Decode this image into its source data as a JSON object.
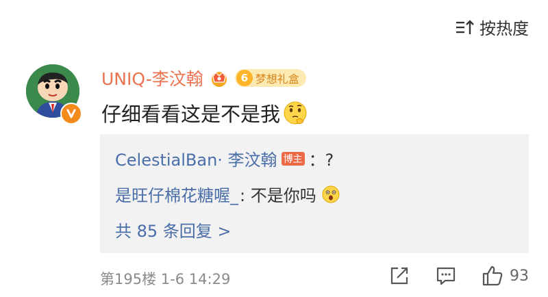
{
  "sort": {
    "label": "按热度"
  },
  "comment": {
    "username": "UNIQ-李汶翰",
    "badge_level": "6",
    "badge_label": "梦想礼盒",
    "text": "仔细看看这是不是我",
    "floor": "第195楼",
    "date": "1-6",
    "time": "14:29",
    "likes": "93"
  },
  "replies": [
    {
      "author": "CelestialBan· 李汶翰",
      "host_badge": "博主",
      "text": "：?"
    },
    {
      "author": "是旺仔棉花糖喔_",
      "text": ": 不是你吗"
    }
  ],
  "more_replies": "共 85 条回复 >",
  "colors": {
    "username": "#eb7350",
    "reply_author": "#496ea8",
    "reply_bg": "#f2f2f2",
    "host_badge": "#ee6a46",
    "verified": "#f28a1c"
  }
}
